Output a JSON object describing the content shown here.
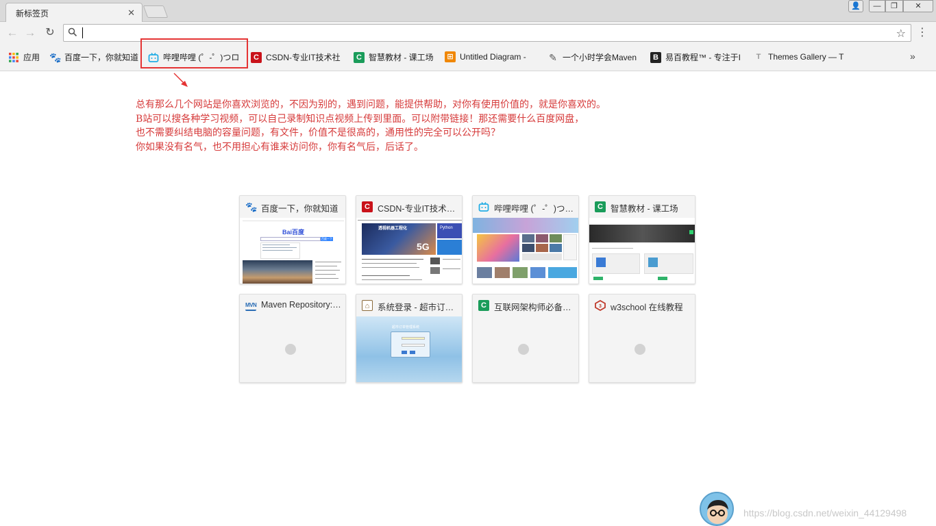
{
  "browser": {
    "tab_title": "新标签页",
    "tab_close": "✕",
    "window_controls": {
      "user": "👤",
      "minimize": "—",
      "maximize": "❐",
      "close": "✕"
    },
    "nav": {
      "back": "←",
      "forward": "→",
      "reload": "↻"
    },
    "omnibox": {
      "value": "",
      "placeholder": ""
    },
    "star": "☆",
    "menu": "⋮"
  },
  "bookmarks": {
    "apps_label": "应用",
    "items": [
      {
        "label": "百度一下，你就知道",
        "icon": "baidu-paw-icon",
        "color": "#2f6fe4"
      },
      {
        "label": "哔哩哔哩 (゜-゜)つロ",
        "icon": "bilibili-tv-icon",
        "color": "#23ade5"
      },
      {
        "label": "CSDN-专业IT技术社",
        "icon": "csdn-c-icon",
        "color": "#c9121a"
      },
      {
        "label": "智慧教材 - 课工场",
        "icon": "kgc-c-icon",
        "color": "#1a9c5a"
      },
      {
        "label": "Untitled Diagram - ",
        "icon": "drawio-icon",
        "color": "#f08705"
      },
      {
        "label": "一个小时学会Maven",
        "icon": "feather-icon",
        "color": "#555555"
      },
      {
        "label": "易百教程™ - 专注于I",
        "icon": "yiibai-b-icon",
        "color": "#222222"
      },
      {
        "label": "Themes Gallery — T",
        "icon": "themes-t-icon",
        "color": "#999999"
      }
    ],
    "more": "»"
  },
  "annotation": {
    "lines": [
      "总有那么几个网站是你喜欢浏览的，不因为别的，遇到问题，能提供帮助，对你有使用价值的，就是你喜欢的。",
      "B站可以搜各种学习视频，可以自己录制知识点视频上传到里面。可以附带链接！那还需要什么百度网盘，",
      "也不需要纠结电脑的容量问题，有文件，价值不是很高的，通用性的完全可以公开吗？",
      "你如果没有名气，也不用担心有谁来访问你，你有名气后，后话了。"
    ],
    "color": "#d63a3a"
  },
  "tiles": [
    {
      "title": "百度一下，你就知道",
      "icon": "baidu-paw-icon",
      "color": "#2f6fe4",
      "thumb": "baidu"
    },
    {
      "title": "CSDN-专业IT技术社区",
      "icon": "csdn-c-icon",
      "color": "#c9121a",
      "thumb": "csdn"
    },
    {
      "title": "哔哩哔哩 (゜-゜)つロ 干杯",
      "icon": "bilibili-tv-icon",
      "color": "#23ade5",
      "thumb": "bilibili"
    },
    {
      "title": "智慧教材 - 课工场",
      "icon": "kgc-c-icon",
      "color": "#1a9c5a",
      "thumb": "kgc"
    },
    {
      "title": "Maven Repository: Search",
      "icon": "mvn-icon",
      "color": "#2a6db5",
      "thumb": "empty"
    },
    {
      "title": "系统登录 - 超市订单管理系统",
      "icon": "login-icon",
      "color": "#8a6a3a",
      "thumb": "login"
    },
    {
      "title": "互联网架构师必备技能",
      "icon": "kgc-c-icon",
      "color": "#1a9c5a",
      "thumb": "empty"
    },
    {
      "title": "w3school 在线教程",
      "icon": "w3school-icon",
      "color": "#c0392b",
      "thumb": "empty"
    }
  ],
  "thumb_text": {
    "baidu_logo": "Bai百度",
    "baidu_button": "百度一下",
    "csdn_banner": "透视机器工程化",
    "csdn_5g": "5G",
    "csdn_python": "Python",
    "login_title": "超市订单管理系统"
  },
  "watermark": "https://blog.csdn.net/weixin_44129498",
  "colors": {
    "highlight": "#e53333",
    "arrow": "#e53333"
  }
}
